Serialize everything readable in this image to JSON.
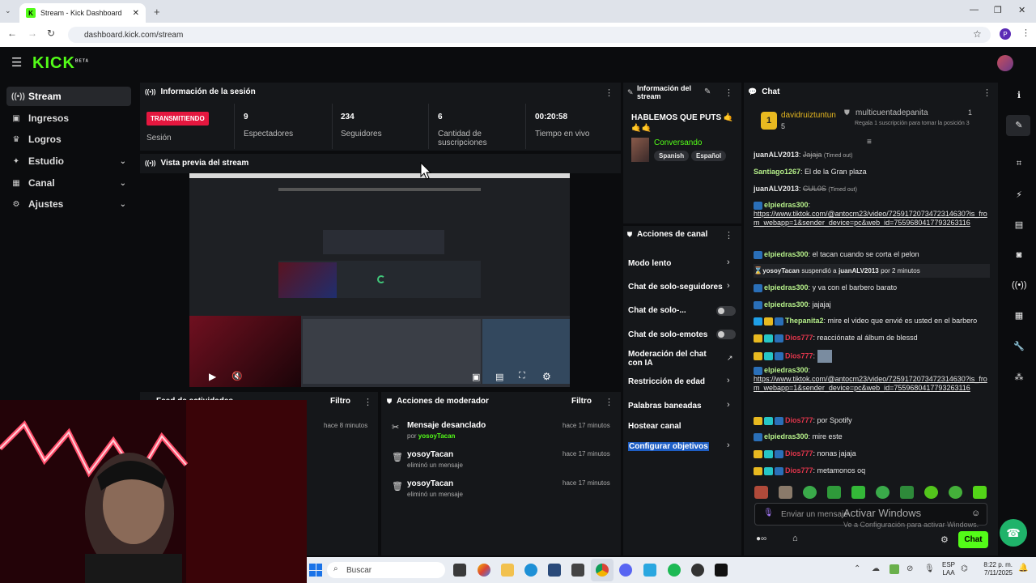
{
  "browser": {
    "tab_title": "Stream - Kick Dashboard",
    "favicon": "K",
    "url": "dashboard.kick.com/stream",
    "profile_initial": "P"
  },
  "header": {
    "logo": "KICK",
    "logo_badge": "BETA"
  },
  "sidebar": {
    "items": [
      {
        "label": "Stream",
        "icon": "broadcast-icon"
      },
      {
        "label": "Ingresos",
        "icon": "money-icon"
      },
      {
        "label": "Logros",
        "icon": "trophy-icon"
      },
      {
        "label": "Estudio",
        "icon": "studio-icon"
      },
      {
        "label": "Canal",
        "icon": "channel-icon"
      },
      {
        "label": "Ajustes",
        "icon": "gear-icon"
      }
    ]
  },
  "session": {
    "title": "Información de la sesión",
    "status": "TRANSMITIENDO",
    "status_label": "Sesión",
    "stats": [
      {
        "value": "9",
        "label": "Espectadores"
      },
      {
        "value": "234",
        "label": "Seguidores"
      },
      {
        "value": "6",
        "label": "Cantidad de suscripciones"
      },
      {
        "value": "00:20:58",
        "label": "Tiempo en vivo"
      }
    ]
  },
  "stream_info": {
    "title": "Información del stream",
    "stream_title": "HABLEMOS QUE PUTS 🤙 🤙🤙",
    "category": "Conversando",
    "tags": [
      "Spanish",
      "Español"
    ]
  },
  "preview": {
    "title": "Vista previa del stream"
  },
  "activity": {
    "title": "Feed de actividades",
    "filter": "Filtro",
    "time": "hace 8 minutos"
  },
  "mod_actions": {
    "title": "Acciones de moderador",
    "filter": "Filtro",
    "items": [
      {
        "action": "Mensaje desanclado",
        "by_prefix": "por",
        "by": "yosoyTacan",
        "time": "hace 17 minutos"
      },
      {
        "action": "yosoyTacan",
        "by_prefix": "eliminó un mensaje",
        "by": "",
        "time": "hace 17 minutos"
      },
      {
        "action": "yosoyTacan",
        "by_prefix": "eliminó un mensaje",
        "by": "",
        "time": "hace 17 minutos"
      }
    ]
  },
  "channel_actions": {
    "title": "Acciones de canal",
    "items": [
      "Modo lento",
      "Chat de solo-seguidores",
      "Chat de solo-...",
      "Chat de solo-emotes",
      "Moderación del chat con IA",
      "Restricción de edad",
      "Palabras baneadas",
      "Hostear canal",
      "Configurar objetivos"
    ]
  },
  "chat": {
    "title": "Chat",
    "top_user": "davidruiztuntun",
    "top_rank": "1",
    "top_count": "5",
    "gift_user": "multicuentadepanita",
    "gift_count": "1",
    "gift_text": "Regala 1 suscripción para tomar la posición 3",
    "messages": [
      {
        "user": "juanALV2013",
        "text": "Jajaja",
        "note": "(Timed out)",
        "color": "#e6e6e6"
      },
      {
        "user": "Santiago1267",
        "text": "El de la Gran plaza",
        "note": "",
        "color": "#b6f08a"
      },
      {
        "user": "juanALV2013",
        "text": "CUL0S",
        "note": "(Timed out)",
        "color": "#e6e6e6"
      },
      {
        "user": "elpiedras300",
        "text": "https://www.tiktok.com/@antocm23/video/7259172073472314630?is_from_webapp=1&sender_device=pc&web_id=7559680417793263116",
        "note": "",
        "color": "#b6f08a"
      },
      {
        "user": "elpiedras300",
        "text": "el tacan cuando se corta el pelon",
        "note": "",
        "color": "#b6f08a"
      },
      {
        "user": "yosoyTacan",
        "text": "suspendió a",
        "target": "juanALV2013",
        "note": "por 2 minutos",
        "color": "#e6e6e6"
      },
      {
        "user": "elpiedras300",
        "text": "y va con el barbero barato",
        "note": "",
        "color": "#b6f08a"
      },
      {
        "user": "elpiedras300",
        "text": "jajajaj",
        "note": "",
        "color": "#b6f08a"
      },
      {
        "user": "Thepanita2",
        "text": "mire el video que envié es usted en el barbero",
        "note": "",
        "color": "#b6f08a"
      },
      {
        "user": "Dios777",
        "text": "reacciónate al álbum de blessd",
        "note": "",
        "color": "#e0354b"
      },
      {
        "user": "Dios777",
        "text": "",
        "note": "",
        "color": "#e0354b"
      },
      {
        "user": "elpiedras300",
        "text": "https://www.tiktok.com/@antocm23/video/7259172073472314630?is_from_webapp=1&sender_device=pc&web_id=7559680417793263116",
        "note": "",
        "color": "#b6f08a"
      },
      {
        "user": "Dios777",
        "text": "por Spotify",
        "note": "",
        "color": "#e0354b"
      },
      {
        "user": "elpiedras300",
        "text": "mire este",
        "note": "",
        "color": "#b6f08a"
      },
      {
        "user": "Dios777",
        "text": "nonas jajaja",
        "note": "",
        "color": "#e0354b"
      },
      {
        "user": "Dios777",
        "text": "metamonos oq",
        "note": "",
        "color": "#e0354b"
      }
    ],
    "input_placeholder": "Enviar un mensaje",
    "send_label": "Chat"
  },
  "windows": {
    "activate_title": "Activar Windows",
    "activate_sub": "Ve a Configuración para activar Windows.",
    "search": "Buscar",
    "lang": "ESP",
    "lang_sub": "LAA",
    "time": "8:22 p. m.",
    "date": "7/11/2025"
  },
  "colors": {
    "kick_green": "#53fc18",
    "live_red": "#e5173f",
    "panel": "#15171a"
  }
}
